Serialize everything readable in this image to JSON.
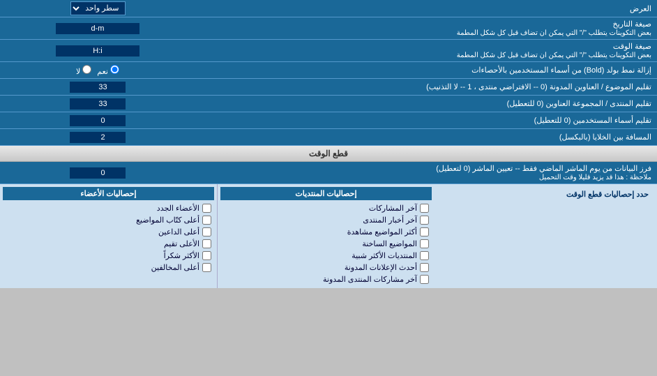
{
  "header": {
    "label": "العرض",
    "dropdown_label": "سطر واحد"
  },
  "rows": [
    {
      "id": "date_format",
      "label": "صيغة التاريخ",
      "sublabel": "بعض التكوينات يتطلب \"/\" التي يمكن ان تضاف قبل كل شكل المطمة",
      "value": "d-m",
      "type": "text"
    },
    {
      "id": "time_format",
      "label": "صيغة الوقت",
      "sublabel": "بعض التكوينات يتطلب \"/\" التي يمكن ان تضاف قبل كل شكل المطمة",
      "value": "H:i",
      "type": "text"
    },
    {
      "id": "bold_remove",
      "label": "إزالة نمط بولد (Bold) من أسماء المستخدمين بالأحصاءات",
      "type": "radio",
      "options": [
        "نعم",
        "لا"
      ],
      "selected": "نعم"
    },
    {
      "id": "topic_limit",
      "label": "تقليم الموضوع / العناوين المدونة (0 -- الافتراضي منتدى ، 1 -- لا التذنيب)",
      "value": "33",
      "type": "number"
    },
    {
      "id": "forum_limit",
      "label": "تقليم المنتدى / المجموعة العناوين (0 للتعطيل)",
      "value": "33",
      "type": "number"
    },
    {
      "id": "username_limit",
      "label": "تقليم أسماء المستخدمين (0 للتعطيل)",
      "value": "0",
      "type": "number"
    },
    {
      "id": "gap",
      "label": "المسافة بين الخلايا (بالبكسل)",
      "value": "2",
      "type": "number"
    }
  ],
  "time_section": {
    "header": "قطع الوقت",
    "row": {
      "label": "فرز البيانات من يوم الماشر الماضي فقط -- تعيين الماشر (0 لتعطيل)",
      "sublabel": "ملاحظة : هذا قد يزيد قليلا وقت التحميل",
      "value": "0"
    },
    "stats_label": "حدد إحصاليات قطع الوقت"
  },
  "stats_posts": {
    "header": "إحصاليات المنتديات",
    "items": [
      "آخر المشاركات",
      "آخر أخبار المنتدى",
      "أكثر المواضيع مشاهدة",
      "المواضيع الساخنة",
      "المنتديات الأكثر شبية",
      "أحدث الإعلانات المدونة",
      "آخر مشاركات المنتدى المدونة"
    ]
  },
  "stats_members": {
    "header": "إحصاليات الأعضاء",
    "items": [
      "الأعضاء الجدد",
      "أعلى كتّاب المواضيع",
      "أعلى الداعين",
      "الأعلى تقيم",
      "الأكثر شكراً",
      "أعلى المخالفين"
    ]
  }
}
